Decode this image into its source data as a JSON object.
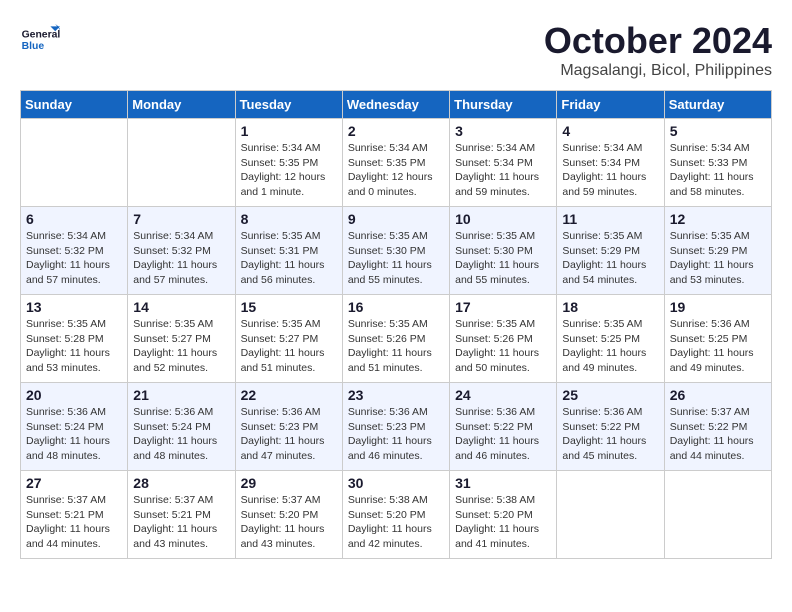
{
  "header": {
    "logo_general": "General",
    "logo_blue": "Blue",
    "month_title": "October 2024",
    "location": "Magsalangi, Bicol, Philippines"
  },
  "weekdays": [
    "Sunday",
    "Monday",
    "Tuesday",
    "Wednesday",
    "Thursday",
    "Friday",
    "Saturday"
  ],
  "weeks": [
    [
      {
        "day": "",
        "detail": ""
      },
      {
        "day": "",
        "detail": ""
      },
      {
        "day": "1",
        "detail": "Sunrise: 5:34 AM\nSunset: 5:35 PM\nDaylight: 12 hours\nand 1 minute."
      },
      {
        "day": "2",
        "detail": "Sunrise: 5:34 AM\nSunset: 5:35 PM\nDaylight: 12 hours\nand 0 minutes."
      },
      {
        "day": "3",
        "detail": "Sunrise: 5:34 AM\nSunset: 5:34 PM\nDaylight: 11 hours\nand 59 minutes."
      },
      {
        "day": "4",
        "detail": "Sunrise: 5:34 AM\nSunset: 5:34 PM\nDaylight: 11 hours\nand 59 minutes."
      },
      {
        "day": "5",
        "detail": "Sunrise: 5:34 AM\nSunset: 5:33 PM\nDaylight: 11 hours\nand 58 minutes."
      }
    ],
    [
      {
        "day": "6",
        "detail": "Sunrise: 5:34 AM\nSunset: 5:32 PM\nDaylight: 11 hours\nand 57 minutes."
      },
      {
        "day": "7",
        "detail": "Sunrise: 5:34 AM\nSunset: 5:32 PM\nDaylight: 11 hours\nand 57 minutes."
      },
      {
        "day": "8",
        "detail": "Sunrise: 5:35 AM\nSunset: 5:31 PM\nDaylight: 11 hours\nand 56 minutes."
      },
      {
        "day": "9",
        "detail": "Sunrise: 5:35 AM\nSunset: 5:30 PM\nDaylight: 11 hours\nand 55 minutes."
      },
      {
        "day": "10",
        "detail": "Sunrise: 5:35 AM\nSunset: 5:30 PM\nDaylight: 11 hours\nand 55 minutes."
      },
      {
        "day": "11",
        "detail": "Sunrise: 5:35 AM\nSunset: 5:29 PM\nDaylight: 11 hours\nand 54 minutes."
      },
      {
        "day": "12",
        "detail": "Sunrise: 5:35 AM\nSunset: 5:29 PM\nDaylight: 11 hours\nand 53 minutes."
      }
    ],
    [
      {
        "day": "13",
        "detail": "Sunrise: 5:35 AM\nSunset: 5:28 PM\nDaylight: 11 hours\nand 53 minutes."
      },
      {
        "day": "14",
        "detail": "Sunrise: 5:35 AM\nSunset: 5:27 PM\nDaylight: 11 hours\nand 52 minutes."
      },
      {
        "day": "15",
        "detail": "Sunrise: 5:35 AM\nSunset: 5:27 PM\nDaylight: 11 hours\nand 51 minutes."
      },
      {
        "day": "16",
        "detail": "Sunrise: 5:35 AM\nSunset: 5:26 PM\nDaylight: 11 hours\nand 51 minutes."
      },
      {
        "day": "17",
        "detail": "Sunrise: 5:35 AM\nSunset: 5:26 PM\nDaylight: 11 hours\nand 50 minutes."
      },
      {
        "day": "18",
        "detail": "Sunrise: 5:35 AM\nSunset: 5:25 PM\nDaylight: 11 hours\nand 49 minutes."
      },
      {
        "day": "19",
        "detail": "Sunrise: 5:36 AM\nSunset: 5:25 PM\nDaylight: 11 hours\nand 49 minutes."
      }
    ],
    [
      {
        "day": "20",
        "detail": "Sunrise: 5:36 AM\nSunset: 5:24 PM\nDaylight: 11 hours\nand 48 minutes."
      },
      {
        "day": "21",
        "detail": "Sunrise: 5:36 AM\nSunset: 5:24 PM\nDaylight: 11 hours\nand 48 minutes."
      },
      {
        "day": "22",
        "detail": "Sunrise: 5:36 AM\nSunset: 5:23 PM\nDaylight: 11 hours\nand 47 minutes."
      },
      {
        "day": "23",
        "detail": "Sunrise: 5:36 AM\nSunset: 5:23 PM\nDaylight: 11 hours\nand 46 minutes."
      },
      {
        "day": "24",
        "detail": "Sunrise: 5:36 AM\nSunset: 5:22 PM\nDaylight: 11 hours\nand 46 minutes."
      },
      {
        "day": "25",
        "detail": "Sunrise: 5:36 AM\nSunset: 5:22 PM\nDaylight: 11 hours\nand 45 minutes."
      },
      {
        "day": "26",
        "detail": "Sunrise: 5:37 AM\nSunset: 5:22 PM\nDaylight: 11 hours\nand 44 minutes."
      }
    ],
    [
      {
        "day": "27",
        "detail": "Sunrise: 5:37 AM\nSunset: 5:21 PM\nDaylight: 11 hours\nand 44 minutes."
      },
      {
        "day": "28",
        "detail": "Sunrise: 5:37 AM\nSunset: 5:21 PM\nDaylight: 11 hours\nand 43 minutes."
      },
      {
        "day": "29",
        "detail": "Sunrise: 5:37 AM\nSunset: 5:20 PM\nDaylight: 11 hours\nand 43 minutes."
      },
      {
        "day": "30",
        "detail": "Sunrise: 5:38 AM\nSunset: 5:20 PM\nDaylight: 11 hours\nand 42 minutes."
      },
      {
        "day": "31",
        "detail": "Sunrise: 5:38 AM\nSunset: 5:20 PM\nDaylight: 11 hours\nand 41 minutes."
      },
      {
        "day": "",
        "detail": ""
      },
      {
        "day": "",
        "detail": ""
      }
    ]
  ]
}
